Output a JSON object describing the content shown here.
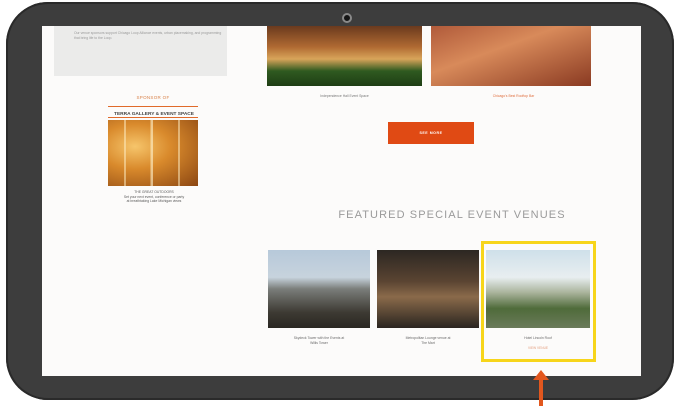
{
  "device": {
    "camera": "webcam-icon"
  },
  "sidebar": {
    "intro_text": "Our venue sponsors support Chicago Loop Alliance events, urban placemaking, and programming that bring life to the Loop.",
    "sponsor_label": "SPONSOR OF",
    "sponsor_name": "TERRA GALLERY & EVENT SPACE",
    "sponsor_caption": "THE GREAT OUTDOORS\nSet your next event, conference or party\nat breathtaking Lake Michigan views"
  },
  "top_venues": [
    {
      "caption": "Independence Hall Event Space"
    },
    {
      "caption": "Chicago's Best Rooftop Bar"
    }
  ],
  "see_more_label": "SEE MORE",
  "featured": {
    "title": "FEATURED SPECIAL EVENT VENUES",
    "venues": [
      {
        "caption": "Skydeck Tower with the Events at\nWillis Tower",
        "sub": ""
      },
      {
        "caption": "Metropolitan Lounge venue at\nThe Mart",
        "sub": ""
      },
      {
        "caption": "Hotel Lincoln Roof",
        "sub": "VIEW VENUE"
      }
    ]
  },
  "annotations": {
    "highlight_color": "#f7d51a",
    "arrow_color": "#e2571e"
  }
}
